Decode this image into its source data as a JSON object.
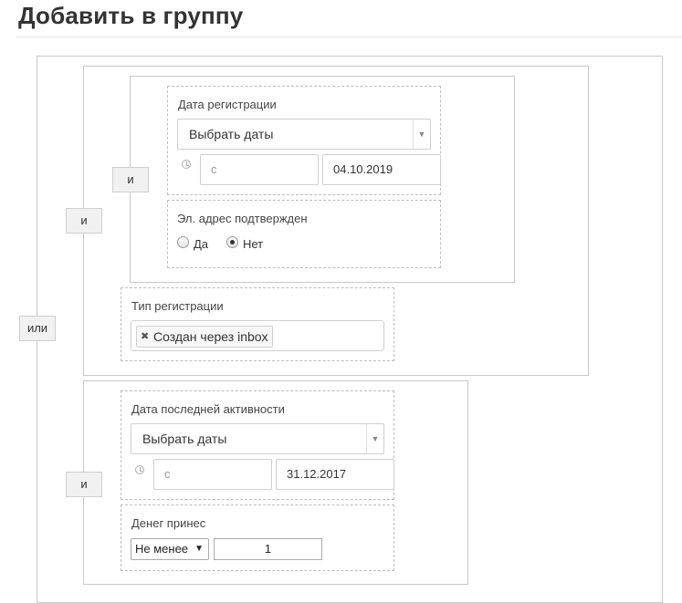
{
  "page": {
    "title": "Добавить в группу"
  },
  "operators": {
    "or": "или",
    "and": "и"
  },
  "registration_date": {
    "label": "Дата регистрации",
    "select_value": "Выбрать даты",
    "from_placeholder": "с",
    "to_value": "04.10.2019"
  },
  "email_confirmed": {
    "label": "Эл. адрес подтвержден",
    "options": [
      "Да",
      "Нет"
    ],
    "selected": "Нет"
  },
  "registration_type": {
    "label": "Тип регистрации",
    "tags": [
      "Создан через inbox"
    ]
  },
  "last_activity_date": {
    "label": "Дата последней активности",
    "select_value": "Выбрать даты",
    "from_placeholder": "с",
    "to_value": "31.12.2017"
  },
  "money_brought": {
    "label": "Денег принес",
    "comparator": "Не менее",
    "value": "1"
  }
}
